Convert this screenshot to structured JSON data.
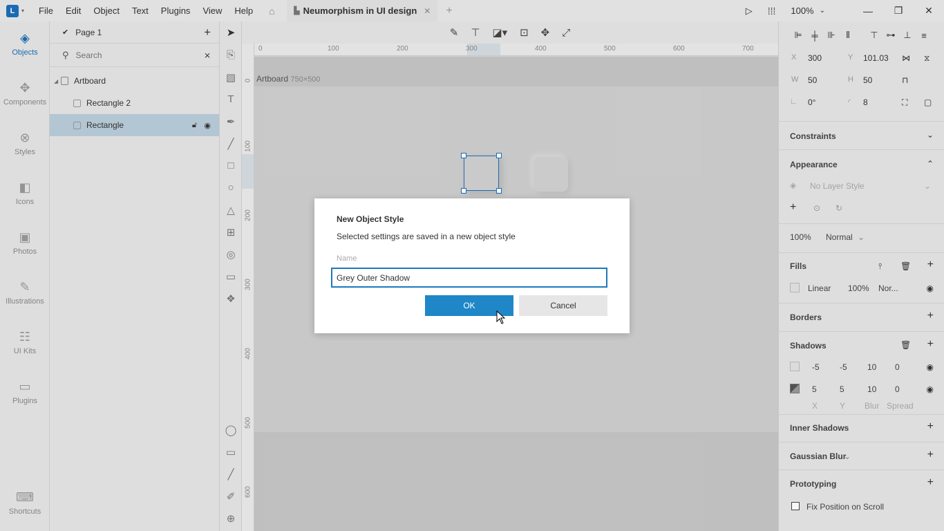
{
  "app": {
    "logo": "L",
    "menu": [
      "File",
      "Edit",
      "Object",
      "Text",
      "Plugins",
      "View",
      "Help"
    ],
    "tab_title": "Neumorphism in UI design",
    "zoom": "100%"
  },
  "leftnav": [
    {
      "label": "Objects",
      "icon": "objects-icon"
    },
    {
      "label": "Components",
      "icon": "components-icon"
    },
    {
      "label": "Styles",
      "icon": "styles-icon"
    },
    {
      "label": "Icons",
      "icon": "icons-icon"
    },
    {
      "label": "Photos",
      "icon": "photos-icon"
    },
    {
      "label": "Illustrations",
      "icon": "illustrations-icon"
    },
    {
      "label": "UI Kits",
      "icon": "ui-kits-icon"
    },
    {
      "label": "Plugins",
      "icon": "plugins-icon"
    },
    {
      "label": "Shortcuts",
      "icon": "keyboard-icon"
    }
  ],
  "layers": {
    "page": "Page 1",
    "search_placeholder": "Search",
    "items": [
      {
        "label": "Artboard"
      },
      {
        "label": "Rectangle 2"
      },
      {
        "label": "Rectangle"
      }
    ]
  },
  "rulers": {
    "h": [
      "0",
      "100",
      "200",
      "300",
      "400",
      "500",
      "600",
      "700"
    ],
    "v": [
      "0",
      "100",
      "200",
      "300",
      "400",
      "500",
      "600"
    ]
  },
  "artboard": {
    "name": "Artboard",
    "size": "750×500"
  },
  "props": {
    "x_label": "X",
    "x": "300",
    "y_label": "Y",
    "y": "101.03",
    "w_label": "W",
    "w": "50",
    "h_label": "H",
    "h": "50",
    "rotation": "0°",
    "radius": "8"
  },
  "sections": {
    "constraints": "Constraints",
    "appearance": "Appearance",
    "layer_style": "No Layer Style",
    "opacity": "100%",
    "blend": "Normal",
    "fills": "Fills",
    "fill_type": "Linear",
    "fill_opacity": "100%",
    "fill_blend": "Nor...",
    "borders": "Borders",
    "shadows": "Shadows",
    "shadow1": [
      "-5",
      "-5",
      "10",
      "0"
    ],
    "shadow2": [
      "5",
      "5",
      "10",
      "0"
    ],
    "shadow_cols": [
      "X",
      "Y",
      "Blur",
      "Spread"
    ],
    "inner_shadows": "Inner Shadows",
    "gaussian_blur": "Gaussian Blur",
    "prototyping": "Prototyping",
    "fix_position": "Fix Position on Scroll"
  },
  "dialog": {
    "title": "New Object Style",
    "description": "Selected settings are saved in a new object style",
    "name_label": "Name",
    "name_value": "Grey Outer Shadow",
    "ok": "OK",
    "cancel": "Cancel"
  }
}
